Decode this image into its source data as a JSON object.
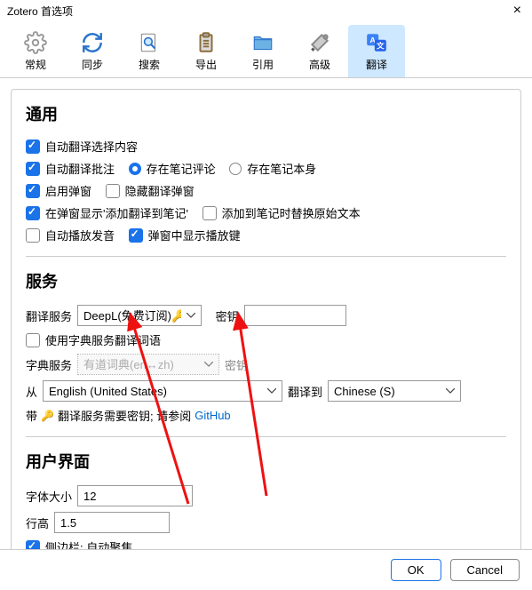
{
  "window": {
    "title": "Zotero 首选项"
  },
  "tabs": [
    {
      "label": "常规"
    },
    {
      "label": "同步"
    },
    {
      "label": "搜索"
    },
    {
      "label": "导出"
    },
    {
      "label": "引用"
    },
    {
      "label": "高级"
    },
    {
      "label": "翻译"
    }
  ],
  "sections": {
    "general": {
      "heading": "通用",
      "auto_translate_selection": "自动翻译选择内容",
      "auto_translate_annotation": "自动翻译批注",
      "radio_store_comment": "存在笔记评论",
      "radio_store_body": "存在笔记本身",
      "enable_popup": "启用弹窗",
      "hide_popup": "隐藏翻译弹窗",
      "show_add_to_note": "在弹窗显示'添加翻译到笔记'",
      "replace_on_add": "添加到笔记时替换原始文本",
      "auto_play": "自动播放发音",
      "show_play_button": "弹窗中显示播放键"
    },
    "service": {
      "heading": "服务",
      "translate_service_label": "翻译服务",
      "translate_service_value": "DeepL(免费订阅)🔑",
      "secret_label": "密钥",
      "use_dict": "使用字典服务翻译词语",
      "dict_service_label": "字典服务",
      "dict_service_value": "有道词典(en↔zh)",
      "dict_secret_label": "密钥",
      "from_label": "从",
      "from_value": "English (United States)",
      "to_label": "翻译到",
      "to_value": "Chinese (S)",
      "hint_prefix": "带",
      "hint_middle": "翻译服务需要密钥; 请参阅",
      "hint_link": "GitHub"
    },
    "ui": {
      "heading": "用户界面",
      "font_size_label": "字体大小",
      "font_size_value": "12",
      "line_height_label": "行高",
      "line_height_value": "1.5",
      "sidebar_autofocus": "侧边栏: 自动聚焦"
    }
  },
  "footer": {
    "ok": "OK",
    "cancel": "Cancel"
  }
}
